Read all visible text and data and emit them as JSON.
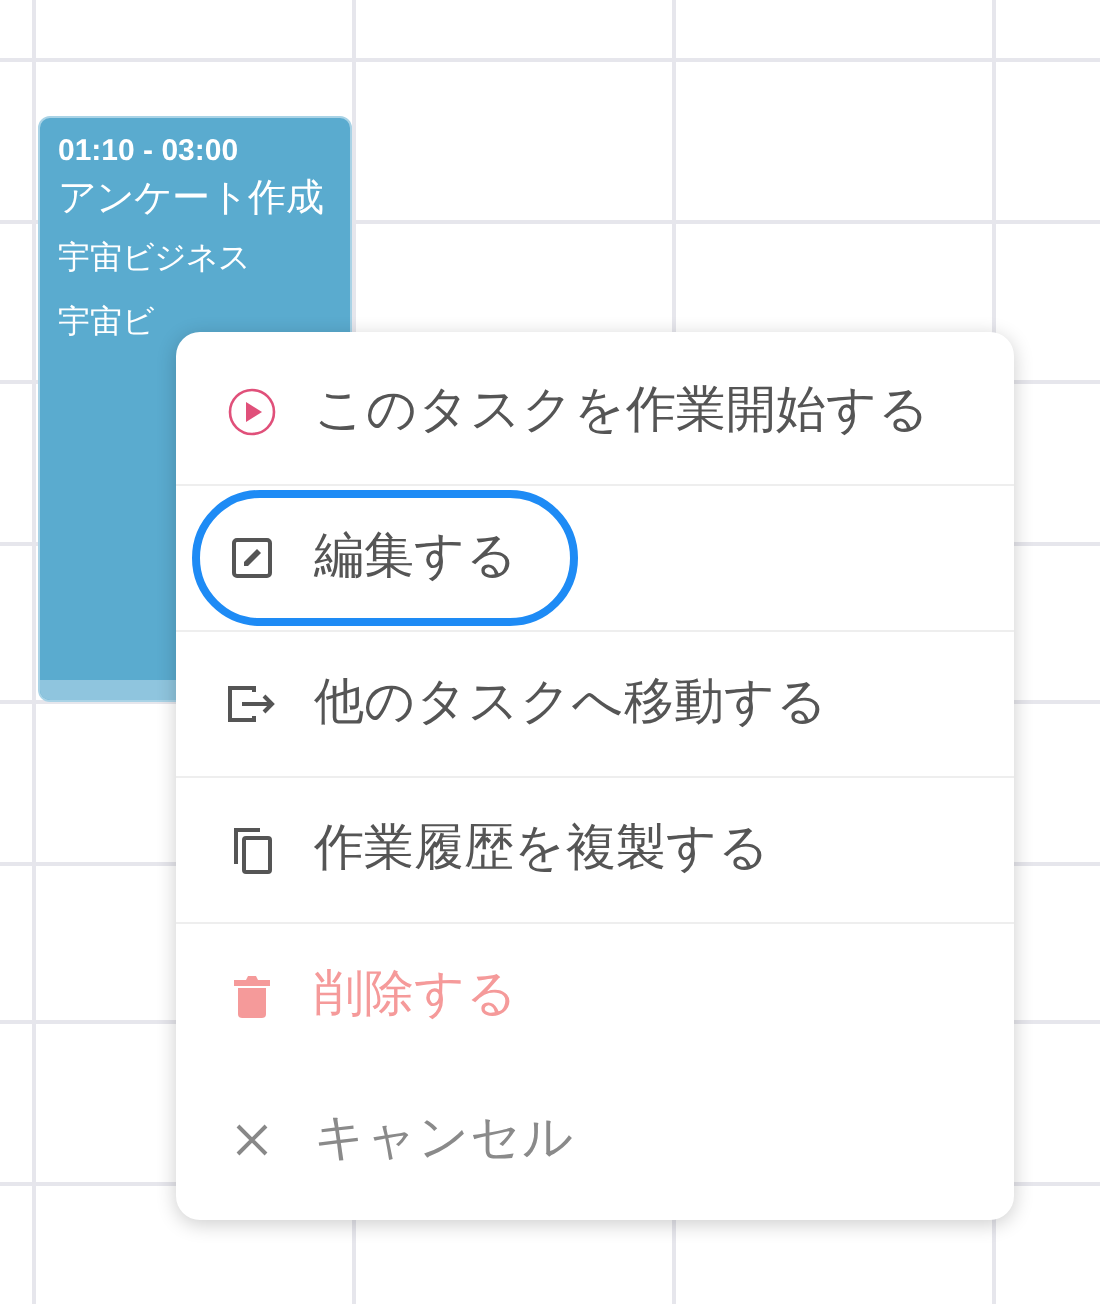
{
  "event": {
    "time": "01:10 - 03:00",
    "title": "アンケート作成",
    "lines": [
      "宇宙ビジネス",
      "宇宙ビ"
    ]
  },
  "menu": {
    "groups": [
      [
        {
          "kind": "play",
          "label": "このタスクを作業開始する",
          "focused": false
        }
      ],
      [
        {
          "kind": "edit",
          "label": "編集する",
          "focused": true
        }
      ],
      [
        {
          "kind": "move",
          "label": "他のタスクへ移動する",
          "focused": false
        }
      ],
      [
        {
          "kind": "copy",
          "label": "作業履歴を複製する",
          "focused": false
        }
      ],
      [
        {
          "kind": "delete",
          "label": "削除する",
          "focused": false
        },
        {
          "kind": "cancel",
          "label": "キャンセル",
          "focused": false
        }
      ]
    ]
  }
}
